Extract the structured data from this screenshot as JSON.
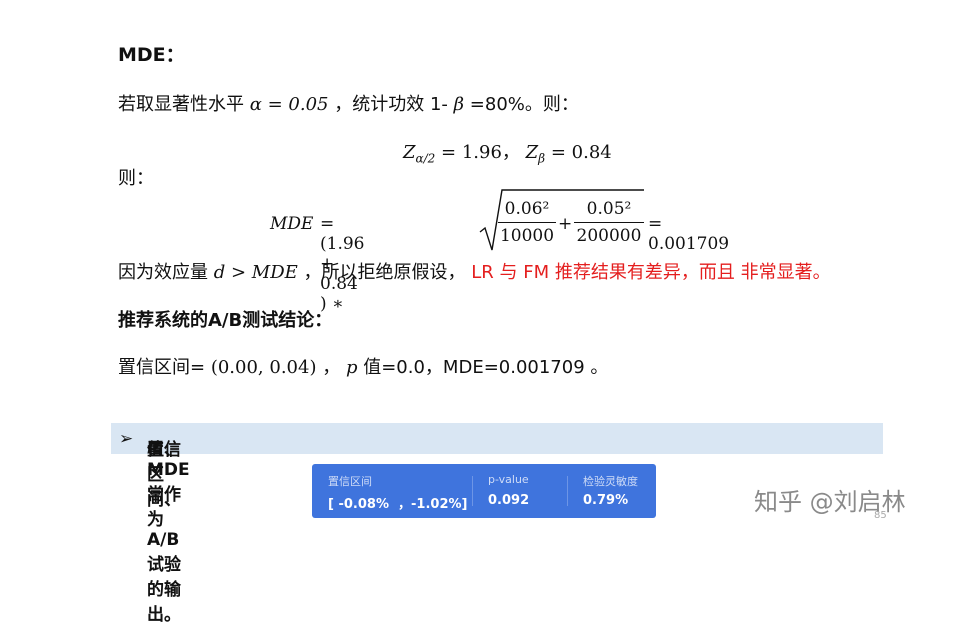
{
  "heading": "MDE：",
  "line1": {
    "prefix": "若取显著性水平",
    "alpha_expr": "α = 0.05",
    "middle": "，统计功效 1-",
    "beta": "β",
    "suffix": "=80%。则："
  },
  "z_values": {
    "z1": "Z",
    "z1_sub": "α/2",
    "z1_val": "= 1.96，",
    "z2": "Z",
    "z2_sub": "β",
    "z2_val": "= 0.84"
  },
  "ze_label": "则：",
  "formula": {
    "lhs": "MDE",
    "eq": "= (1.96 + 0.84 ) ∗",
    "frac1_num": "0.06²",
    "frac1_den": "10000",
    "plus": "+",
    "frac2_num": "0.05²",
    "frac2_den": "200000",
    "result": "= 0.001709"
  },
  "conclusion": {
    "prefix": "因为效应量",
    "expr": "d > MDE",
    "middle": "，所以拒绝原假设，",
    "red": "LR 与 FM 推荐结果有差异，而且 非常显著。"
  },
  "section_title": "推荐系统的A/B测试结论：",
  "result_line": {
    "prefix": "置信区间=",
    "interval": "(0.00, 0.04)",
    "middle": "，",
    "p": "p",
    "suffix": "值=0.0，MDE=0.001709 。"
  },
  "banner": {
    "arrow": "➢",
    "part1": "置信区间、",
    "p": "p",
    "part2": "值、MDE 常作为 A/B试验的输出。"
  },
  "panel": {
    "ci_label": "置信区间",
    "ci_value": "[ -0.08%  ，-1.02%]",
    "p_label": "p-value",
    "p_value": "0.092",
    "sens_label": "检验灵敏度",
    "sens_value": "0.79%"
  },
  "watermark": "知乎 @刘启林",
  "page_number": "85"
}
